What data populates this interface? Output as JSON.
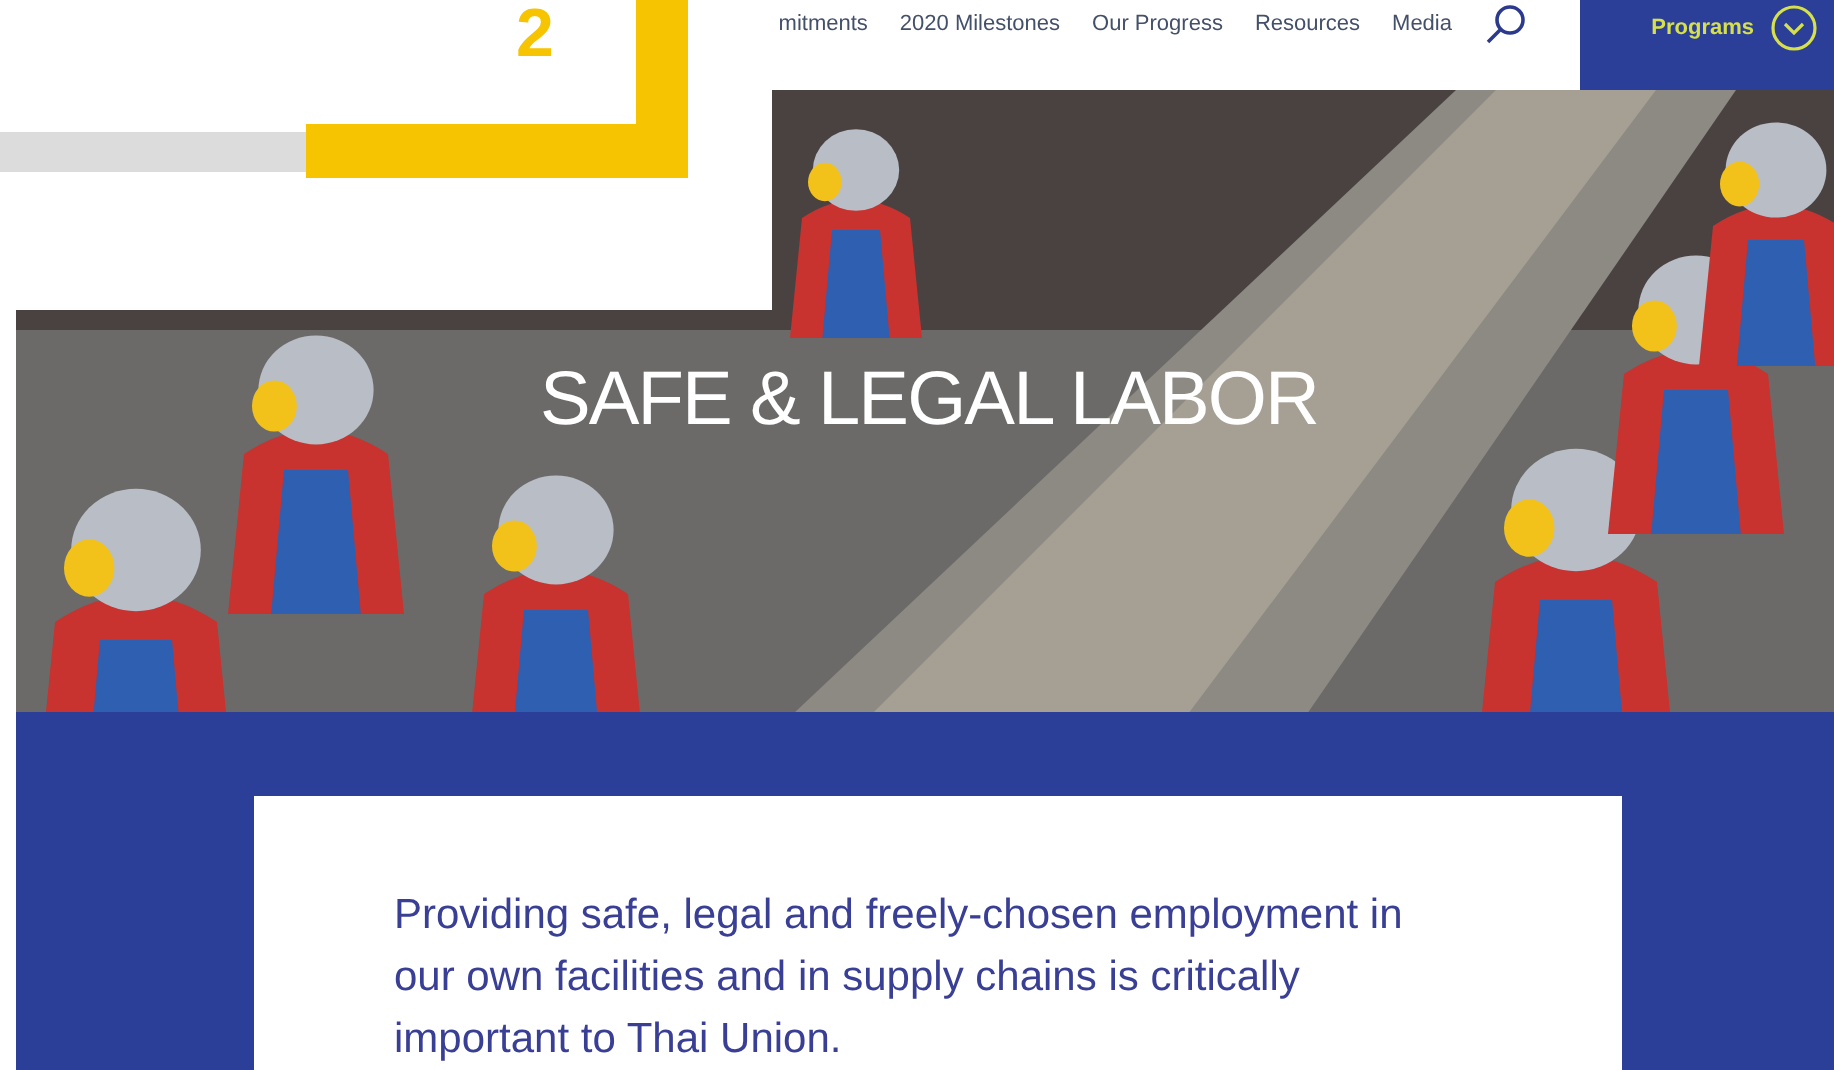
{
  "overlay": {
    "number": "2"
  },
  "nav": {
    "items": [
      "mitments",
      "2020 Milestones",
      "Our Progress",
      "Resources",
      "Media"
    ],
    "programs": "Programs"
  },
  "hero": {
    "title": "SAFE & LEGAL LABOR"
  },
  "intro": {
    "text": "Providing safe, legal and freely-chosen employment in our own facilities and in supply chains is critically important to Thai Union."
  }
}
